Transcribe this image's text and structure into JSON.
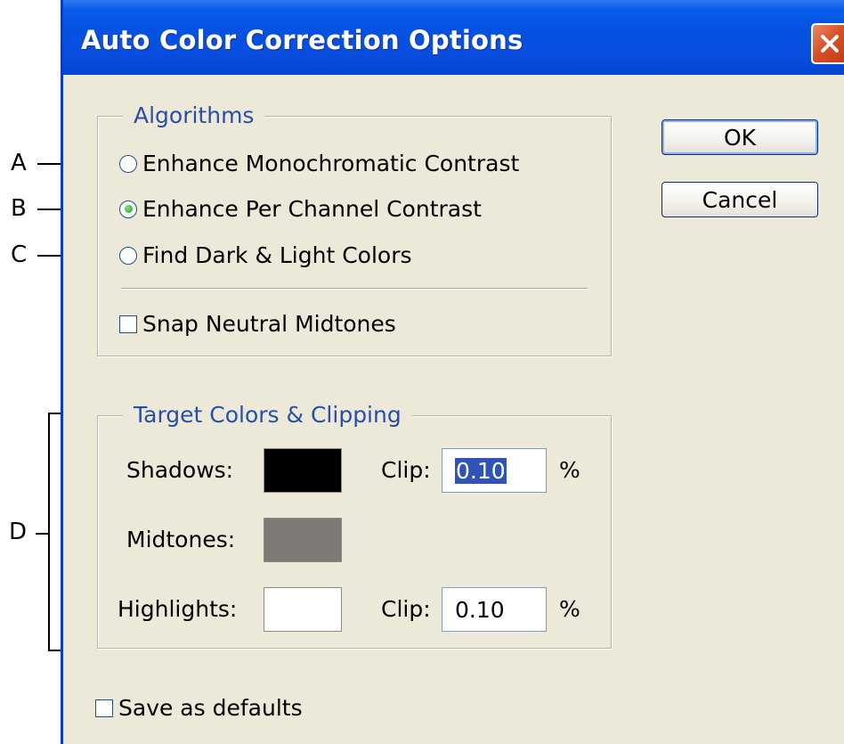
{
  "window": {
    "title": "Auto Color Correction Options"
  },
  "callouts": {
    "a": "A",
    "b": "B",
    "c": "C",
    "d": "D"
  },
  "algorithms": {
    "legend": "Algorithms",
    "options": [
      {
        "label": "Enhance Monochromatic Contrast",
        "selected": false
      },
      {
        "label": "Enhance Per Channel Contrast",
        "selected": true
      },
      {
        "label": "Find Dark & Light Colors",
        "selected": false
      }
    ],
    "snap_neutral_midtones": {
      "label": "Snap Neutral Midtones",
      "checked": false
    }
  },
  "target": {
    "legend": "Target Colors & Clipping",
    "shadows": {
      "label": "Shadows:",
      "color": "#000000",
      "clip_label": "Clip:",
      "clip_value": "0.10",
      "unit": "%"
    },
    "midtones": {
      "label": "Midtones:",
      "color": "#7e7a78"
    },
    "highlights": {
      "label": "Highlights:",
      "color": "#ffffff",
      "clip_label": "Clip:",
      "clip_value": "0.10",
      "unit": "%"
    }
  },
  "buttons": {
    "ok": "OK",
    "cancel": "Cancel"
  },
  "save_defaults": {
    "label": "Save as defaults",
    "checked": false
  }
}
